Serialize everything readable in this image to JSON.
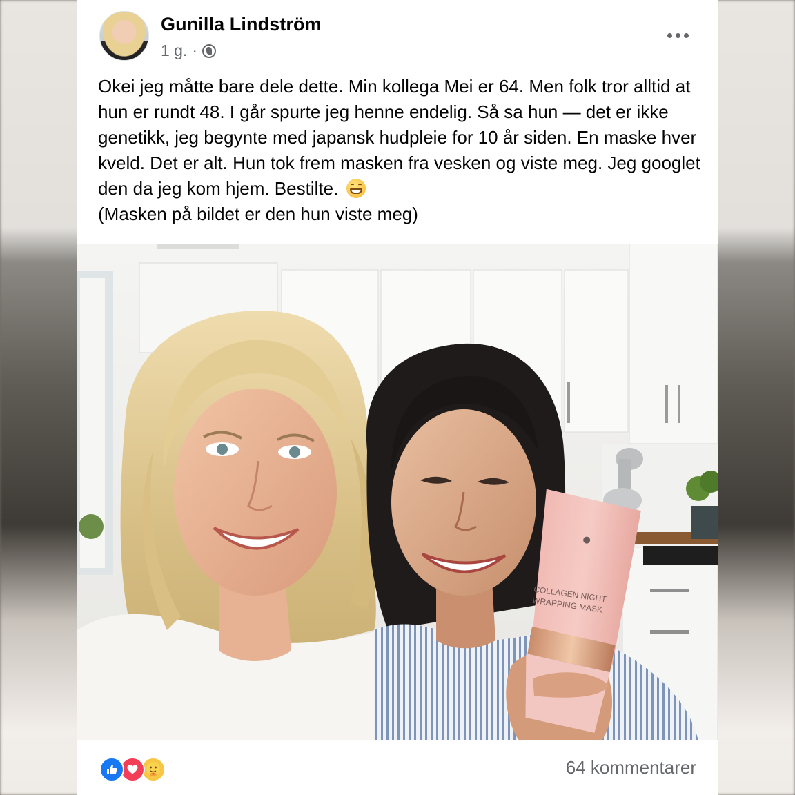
{
  "post": {
    "author": "Gunilla Lindström",
    "time": "1 g.",
    "separator": "·",
    "privacy_icon": "globe-icon",
    "more_icon": "more-dots-icon",
    "text": "Okei jeg måtte bare dele dette. Min kollega Mei er 64. Men folk tror alltid at hun er rundt 48. I går spurte jeg henne endelig. Så sa hun — det er ikke genetikk, jeg begynte med japansk hudpleie for 10 år siden. En maske hver kveld. Det er alt. Hun tok frem masken fra vesken og viste meg. Jeg googlet den da jeg kom hjem. Bestilte.",
    "text_tail": "(Masken på bildet er den hun viste meg)",
    "emoji": "grinning-face-emoji"
  },
  "photo": {
    "product": {
      "line1": "COLLAGEN NIGHT",
      "line2": "WRAPPING MASK"
    }
  },
  "footer": {
    "reactions": [
      "like-icon",
      "love-icon",
      "care-icon"
    ],
    "comments": "64 kommentarer"
  },
  "colors": {
    "text": "#050505",
    "secondary": "#65676b",
    "like": "#1877f2",
    "love": "#f33e58",
    "care": "#f7c644"
  }
}
